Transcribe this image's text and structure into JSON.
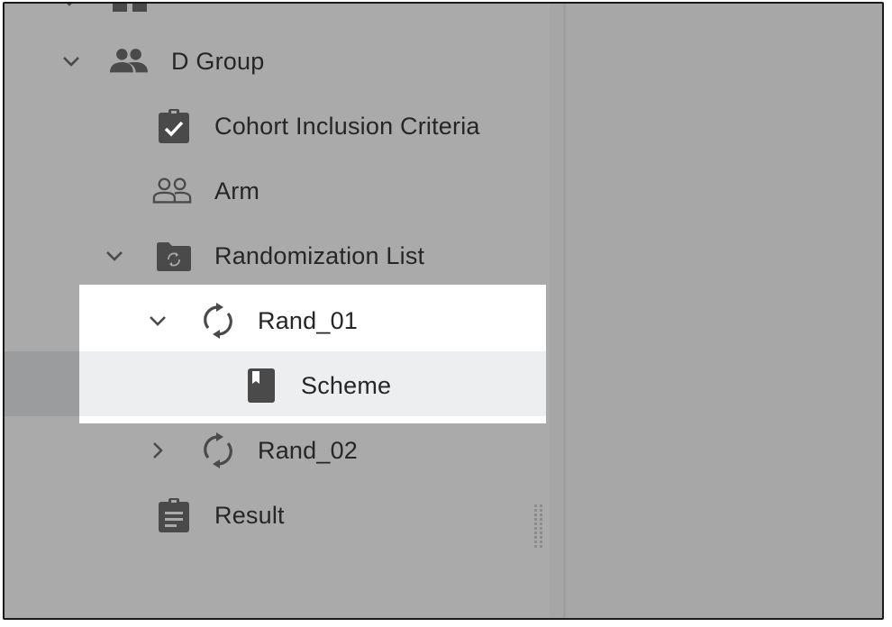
{
  "tree": {
    "items": [
      {
        "label": "D Group",
        "icon": "group-icon",
        "expanded": true
      },
      {
        "label": "Cohort Inclusion Criteria",
        "icon": "clipboard-check-icon"
      },
      {
        "label": "Arm",
        "icon": "people-outline-icon"
      },
      {
        "label": "Randomization List",
        "icon": "folder-sync-icon",
        "expanded": true
      },
      {
        "label": "Rand_01",
        "icon": "sync-icon",
        "expanded": true
      },
      {
        "label": "Scheme",
        "icon": "bookmark-book-icon",
        "selected": true
      },
      {
        "label": "Rand_02",
        "icon": "sync-icon",
        "expanded": false
      },
      {
        "label": "Result",
        "icon": "clipboard-text-icon"
      }
    ]
  },
  "colors": {
    "icon": "#4a4a4a",
    "text": "#262626",
    "backdrop": "#aaaaaa",
    "highlight": "#ffffff",
    "selected": "#edeeef"
  }
}
